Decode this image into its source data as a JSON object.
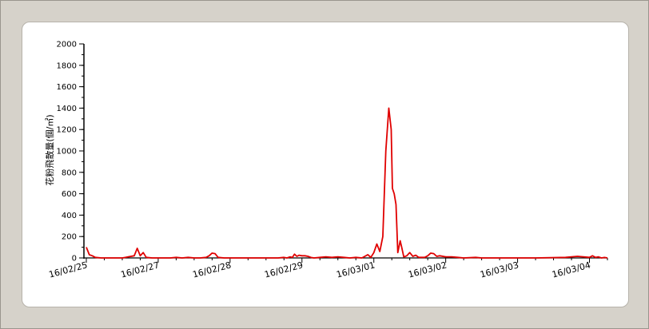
{
  "chart_data": {
    "type": "line",
    "title": "",
    "xlabel": "",
    "ylabel": "花粉飛散量(個/㎡)",
    "ylim": [
      0,
      2000
    ],
    "y_ticks": [
      0,
      200,
      400,
      600,
      800,
      1000,
      1200,
      1400,
      1600,
      1800,
      2000
    ],
    "xlim": [
      0,
      174
    ],
    "x_tick_labels": [
      {
        "x": 0,
        "label": "16/02/25"
      },
      {
        "x": 24,
        "label": "16/02/27"
      },
      {
        "x": 48,
        "label": "16/02/28"
      },
      {
        "x": 72,
        "label": "16/02/29"
      },
      {
        "x": 96,
        "label": "16/03/01"
      },
      {
        "x": 120,
        "label": "16/03/02"
      },
      {
        "x": 144,
        "label": "16/03/03"
      },
      {
        "x": 168,
        "label": "16/03/04"
      }
    ],
    "grid": false,
    "legend": "none",
    "series": [
      {
        "name": "",
        "color": "#e00000",
        "points": [
          [
            0,
            100
          ],
          [
            1,
            30
          ],
          [
            2,
            20
          ],
          [
            3,
            5
          ],
          [
            5,
            0
          ],
          [
            8,
            0
          ],
          [
            12,
            0
          ],
          [
            13,
            5
          ],
          [
            14,
            10
          ],
          [
            16,
            20
          ],
          [
            17,
            90
          ],
          [
            18,
            20
          ],
          [
            19,
            50
          ],
          [
            20,
            5
          ],
          [
            22,
            0
          ],
          [
            28,
            0
          ],
          [
            30,
            5
          ],
          [
            32,
            0
          ],
          [
            34,
            5
          ],
          [
            36,
            0
          ],
          [
            38,
            0
          ],
          [
            40,
            5
          ],
          [
            41,
            20
          ],
          [
            42,
            45
          ],
          [
            43,
            40
          ],
          [
            44,
            5
          ],
          [
            46,
            0
          ],
          [
            60,
            0
          ],
          [
            64,
            0
          ],
          [
            66,
            5
          ],
          [
            67,
            0
          ],
          [
            68,
            10
          ],
          [
            68.8,
            5
          ],
          [
            69.5,
            35
          ],
          [
            70.3,
            15
          ],
          [
            71,
            25
          ],
          [
            72,
            20
          ],
          [
            73,
            20
          ],
          [
            74,
            15
          ],
          [
            75,
            5
          ],
          [
            76,
            0
          ],
          [
            78,
            5
          ],
          [
            80,
            10
          ],
          [
            82,
            5
          ],
          [
            84,
            10
          ],
          [
            86,
            5
          ],
          [
            88,
            0
          ],
          [
            90,
            5
          ],
          [
            92,
            0
          ],
          [
            93,
            15
          ],
          [
            94,
            30
          ],
          [
            95,
            5
          ],
          [
            96,
            50
          ],
          [
            97,
            130
          ],
          [
            98,
            60
          ],
          [
            99,
            200
          ],
          [
            100,
            1000
          ],
          [
            101,
            1400
          ],
          [
            101.8,
            1200
          ],
          [
            102.2,
            650
          ],
          [
            102.8,
            600
          ],
          [
            103.4,
            500
          ],
          [
            104,
            50
          ],
          [
            104.8,
            160
          ],
          [
            105.3,
            100
          ],
          [
            106,
            10
          ],
          [
            107,
            20
          ],
          [
            108,
            50
          ],
          [
            109,
            15
          ],
          [
            110,
            25
          ],
          [
            111,
            5
          ],
          [
            113,
            5
          ],
          [
            114,
            20
          ],
          [
            115,
            45
          ],
          [
            116,
            40
          ],
          [
            117,
            15
          ],
          [
            118,
            20
          ],
          [
            120,
            10
          ],
          [
            122,
            10
          ],
          [
            124,
            5
          ],
          [
            126,
            0
          ],
          [
            130,
            5
          ],
          [
            132,
            0
          ],
          [
            134,
            0
          ],
          [
            140,
            0
          ],
          [
            150,
            0
          ],
          [
            160,
            5
          ],
          [
            162,
            10
          ],
          [
            164,
            15
          ],
          [
            166,
            10
          ],
          [
            168,
            5
          ],
          [
            169,
            20
          ],
          [
            170,
            5
          ],
          [
            171,
            10
          ],
          [
            172,
            0
          ],
          [
            173,
            5
          ],
          [
            174,
            0
          ]
        ]
      }
    ]
  }
}
